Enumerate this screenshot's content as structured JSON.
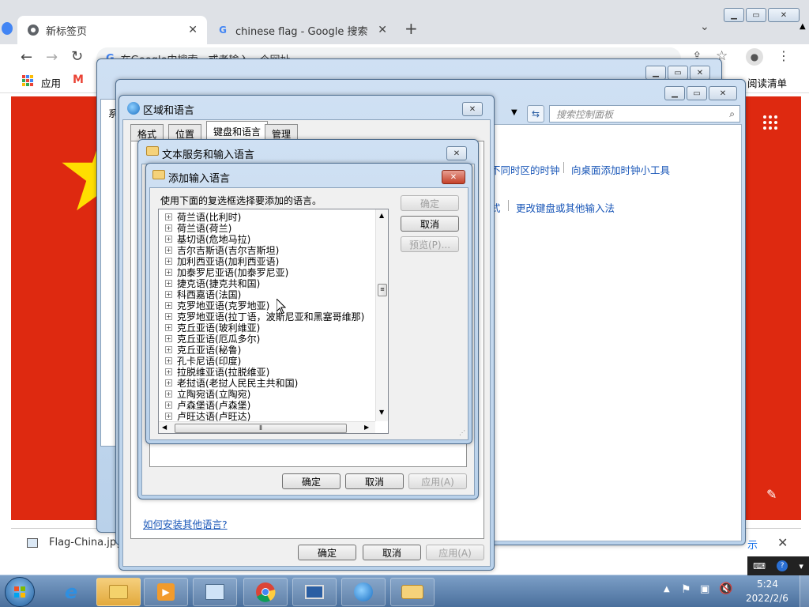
{
  "browser": {
    "tabs": [
      {
        "title": "新标签页",
        "icon": "chrome-icon",
        "active": true
      },
      {
        "title": "chinese flag - Google 搜索",
        "icon": "google-icon",
        "active": false
      }
    ],
    "new_tab": "+",
    "omnibox_placeholder": "在Google中搜索，或者输入一个网址",
    "bookmarks": {
      "apps": "应用",
      "gmail": "M",
      "reading_list": "阅读清单"
    },
    "download_file": "Flag-China.jpg",
    "right_partial": "示"
  },
  "control_panel": {
    "search_placeholder": "搜索控制面板",
    "link_time_zones": "不同时区的时钟",
    "link_gadget": "向桌面添加时钟小工具",
    "link_keyboard": "更改键盘或其他输入法",
    "partial_left": "式",
    "sidebar_partial": "系"
  },
  "region_dialog": {
    "title": "区域和语言",
    "tabs": [
      "格式",
      "位置",
      "键盘和语言",
      "管理"
    ],
    "install_link": "如何安装其他语言?",
    "ok": "确定",
    "cancel": "取消",
    "apply": "应用(A)"
  },
  "text_services_dialog": {
    "title": "文本服务和输入语言",
    "ok": "确定",
    "cancel": "取消",
    "apply": "应用(A)"
  },
  "add_language_dialog": {
    "title": "添加输入语言",
    "instruction": "使用下面的复选框选择要添加的语言。",
    "ok": "确定",
    "cancel": "取消",
    "preview": "预览(P)...",
    "languages": [
      "荷兰语(比利时)",
      "荷兰语(荷兰)",
      "基切语(危地马拉)",
      "吉尔吉斯语(吉尔吉斯坦)",
      "加利西亚语(加利西亚语)",
      "加泰罗尼亚语(加泰罗尼亚)",
      "捷克语(捷克共和国)",
      "科西嘉语(法国)",
      "克罗地亚语(克罗地亚)",
      "克罗地亚语(拉丁语，波斯尼亚和黑塞哥维那)",
      "克丘亚语(玻利维亚)",
      "克丘亚语(厄瓜多尔)",
      "克丘亚语(秘鲁)",
      "孔卡尼语(印度)",
      "拉脱维亚语(拉脱维亚)",
      "老挝语(老挝人民民主共和国)",
      "立陶宛语(立陶宛)",
      "卢森堡语(卢森堡)",
      "卢旺达语(卢旺达)"
    ]
  },
  "taskbar": {
    "time": "5:24",
    "date": "2022/2/6"
  }
}
